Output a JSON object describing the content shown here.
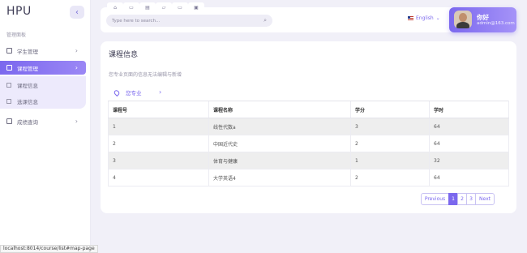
{
  "app": {
    "logo": "HPU",
    "collapse_icon": "‹"
  },
  "sidebar": {
    "section_label": "管理面板",
    "items": [
      {
        "label": "学生管理",
        "icon": "book-icon"
      },
      {
        "label": "课程管理",
        "icon": "table-icon",
        "active": true
      },
      {
        "label": "成绩查询",
        "icon": "clipboard-icon"
      }
    ],
    "sub_items": [
      {
        "label": "课程信息"
      },
      {
        "label": "选课信息"
      }
    ]
  },
  "topbar": {
    "search_placeholder": "Type here to search...",
    "language": "English",
    "user": {
      "greeting": "你好",
      "email": "admin@163.com"
    }
  },
  "main": {
    "title": "课程信息",
    "note": "您专业页面的信息无法编辑与新增",
    "major_link": "您专业",
    "table": {
      "headers": [
        "课程号",
        "课程名称",
        "学分",
        "学时"
      ],
      "rows": [
        [
          "1",
          "线性代数a",
          "3",
          "64"
        ],
        [
          "2",
          "中国近代史",
          "2",
          "64"
        ],
        [
          "3",
          "体育与健康",
          "1",
          "32"
        ],
        [
          "4",
          "大学英语4",
          "2",
          "64"
        ]
      ]
    },
    "pagination": {
      "prev": "Previous",
      "pages": [
        "1",
        "2",
        "3"
      ],
      "active_page": "1",
      "next": "Next"
    }
  },
  "status_url": "localhost:8014/course/list#map-page",
  "colors": {
    "accent": "#7b68ee",
    "background": "#f1f0f8"
  }
}
